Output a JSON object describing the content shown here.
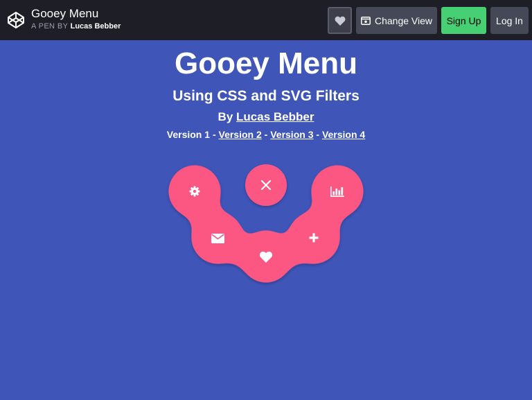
{
  "topbar": {
    "pen_title": "Gooey Menu",
    "pen_prefix": "A PEN BY",
    "pen_author": "Lucas Bebber",
    "heart_icon": "heart-icon",
    "change_view_icon": "window-icon",
    "change_view_label": "Change View",
    "signup_label": "Sign Up",
    "login_label": "Log In"
  },
  "header": {
    "title": "Gooey Menu",
    "subtitle": "Using CSS and SVG Filters",
    "by_prefix": "By",
    "author_link": "Lucas Bebber",
    "versions": [
      {
        "label": "Version 1",
        "link": false
      },
      {
        "label": "Version 2",
        "link": true
      },
      {
        "label": "Version 3",
        "link": true
      },
      {
        "label": "Version 4",
        "link": true
      }
    ],
    "separator": "-"
  },
  "menu": {
    "items": [
      {
        "icon": "gear-icon"
      },
      {
        "icon": "close-icon"
      },
      {
        "icon": "bar-chart-icon"
      },
      {
        "icon": "envelope-icon"
      },
      {
        "icon": "heart-icon"
      },
      {
        "icon": "plus-icon"
      }
    ]
  },
  "colors": {
    "background": "#3f55b8",
    "topbar": "#1e1f26",
    "menu_pink": "#fc5683",
    "signup_green": "#47cf73",
    "button_gray": "#444857"
  }
}
